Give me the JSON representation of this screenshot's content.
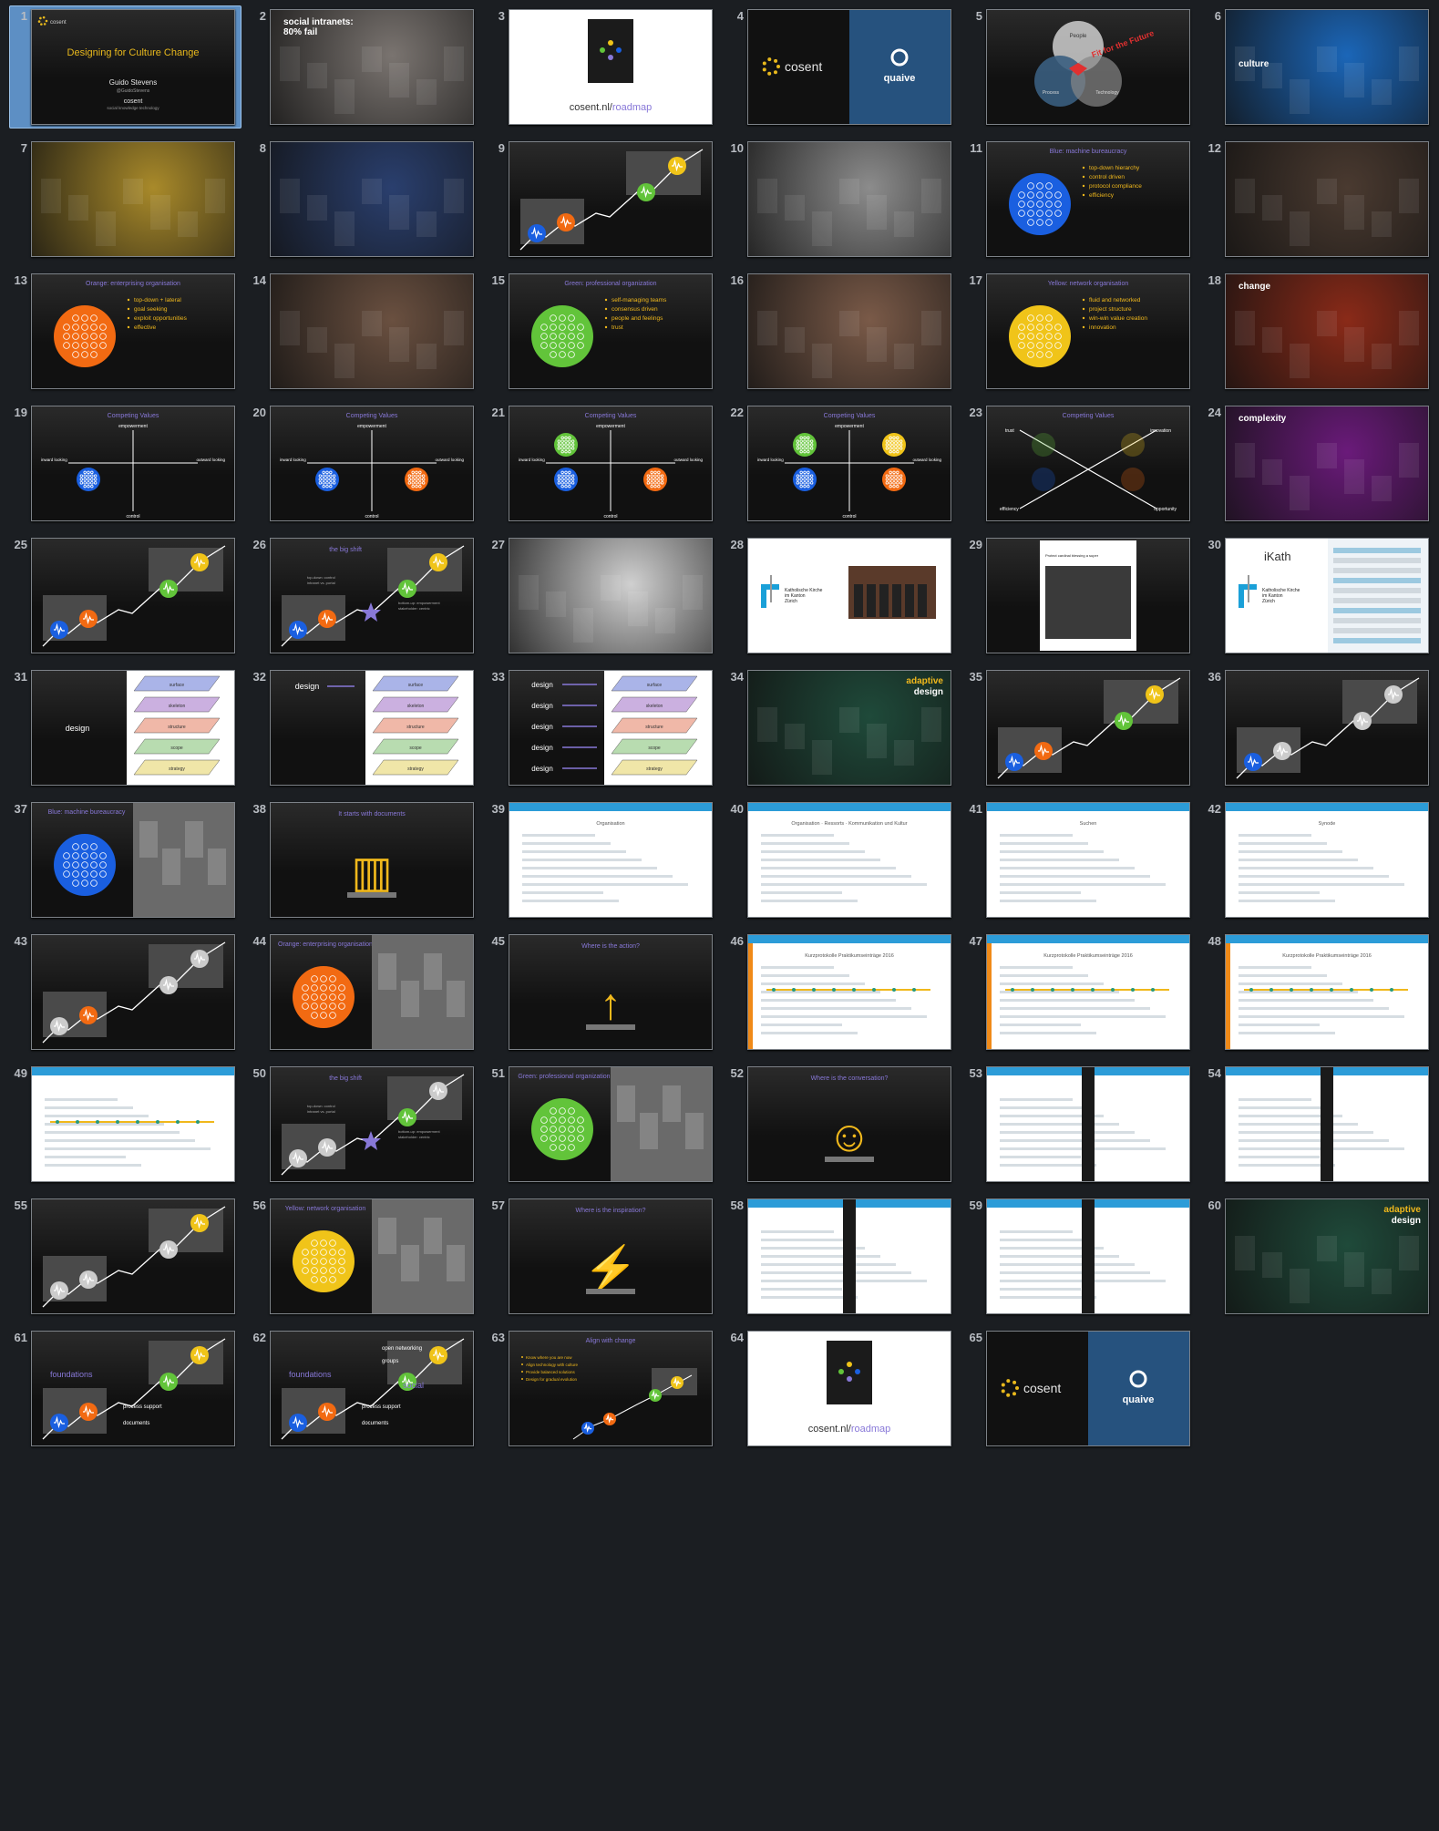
{
  "slides": [
    {
      "n": "1",
      "kind": "title",
      "title": "Designing for Culture Change",
      "author": "Guido Stevens",
      "handle": "@GuidoStevens",
      "brand": "cosent",
      "tagline": "social knowledge technology",
      "logo": "cosent",
      "selected": true
    },
    {
      "n": "2",
      "kind": "photo",
      "caption": "social intranets:\n80% fail",
      "bg": "#7a7470"
    },
    {
      "n": "3",
      "kind": "book",
      "link": "cosent.nl/",
      "link_accent": "roadmap"
    },
    {
      "n": "4",
      "kind": "logos",
      "left": "cosent",
      "right": "quaive"
    },
    {
      "n": "5",
      "kind": "venn",
      "labels": [
        "People",
        "Process",
        "Technology"
      ],
      "stamp": "Fit for the Future"
    },
    {
      "n": "6",
      "kind": "photo",
      "caption": "culture",
      "bg": "#1b66b8"
    },
    {
      "n": "7",
      "kind": "photo",
      "caption": "",
      "bg": "#a98a2a"
    },
    {
      "n": "8",
      "kind": "photo",
      "caption": "",
      "bg": "#2a3f6e"
    },
    {
      "n": "9",
      "kind": "curve",
      "dots": [
        "#1a5fe0",
        "#f26a12",
        "#62c43a",
        "#f0c419"
      ]
    },
    {
      "n": "10",
      "kind": "photo",
      "caption": "",
      "bg": "#8c8c8c"
    },
    {
      "n": "11",
      "kind": "meme",
      "title": "Blue: machine bureaucracy",
      "color": "#1a5fe0",
      "items": [
        "top-down hierarchy",
        "control driven",
        "protocol compliance",
        "efficiency"
      ]
    },
    {
      "n": "12",
      "kind": "photo",
      "caption": "",
      "bg": "#4a3a30"
    },
    {
      "n": "13",
      "kind": "meme",
      "title": "Orange: enterprising organisation",
      "color": "#f26a12",
      "items": [
        "top-down + lateral",
        "goal seeking",
        "exploit opportunities",
        "effective"
      ]
    },
    {
      "n": "14",
      "kind": "photo",
      "caption": "",
      "bg": "#6a5040"
    },
    {
      "n": "15",
      "kind": "meme",
      "title": "Green: professional organization",
      "color": "#62c43a",
      "items": [
        "self-managing teams",
        "consensus driven",
        "people and feelings",
        "trust"
      ]
    },
    {
      "n": "16",
      "kind": "photo",
      "caption": "",
      "bg": "#7a5a48"
    },
    {
      "n": "17",
      "kind": "meme",
      "title": "Yellow: network organisation",
      "color": "#f0c419",
      "items": [
        "fluid and networked",
        "project structure",
        "win-win value creation",
        "innovation"
      ]
    },
    {
      "n": "18",
      "kind": "photo",
      "caption": "change",
      "bg": "#8a2a18"
    },
    {
      "n": "19",
      "kind": "quad",
      "title": "Competing Values",
      "top": "empowerment",
      "bottom": "control",
      "left": "inward looking",
      "right": "outward looking",
      "dots": [
        null,
        null,
        "#1a5fe0",
        null
      ]
    },
    {
      "n": "20",
      "kind": "quad",
      "title": "Competing Values",
      "top": "empowerment",
      "bottom": "control",
      "left": "inward looking",
      "right": "outward looking",
      "dots": [
        null,
        null,
        "#1a5fe0",
        "#f26a12"
      ]
    },
    {
      "n": "21",
      "kind": "quad",
      "title": "Competing Values",
      "top": "empowerment",
      "bottom": "control",
      "left": "inward looking",
      "right": "outward looking",
      "dots": [
        "#62c43a",
        null,
        "#1a5fe0",
        "#f26a12"
      ]
    },
    {
      "n": "22",
      "kind": "quad",
      "title": "Competing Values",
      "top": "empowerment",
      "bottom": "control",
      "left": "inward looking",
      "right": "outward looking",
      "dots": [
        "#62c43a",
        "#f0c419",
        "#1a5fe0",
        "#f26a12"
      ]
    },
    {
      "n": "23",
      "kind": "cross",
      "title": "Competing Values",
      "corners": [
        "trust",
        "innovation",
        "efficiency",
        "opportunity"
      ]
    },
    {
      "n": "24",
      "kind": "photo",
      "caption": "complexity",
      "bg": "#6a1a7a"
    },
    {
      "n": "25",
      "kind": "curve",
      "dots": [
        "#1a5fe0",
        "#f26a12",
        "#62c43a",
        "#f0c419"
      ]
    },
    {
      "n": "26",
      "kind": "curve",
      "dots": [
        "#1a5fe0",
        "#f26a12",
        "#62c43a",
        "#f0c419"
      ],
      "title": "the big shift",
      "star": true,
      "notes": [
        "top-down: control",
        "intranet vs. portal",
        "bottom-up: empowerment",
        "stakeholder: centric"
      ]
    },
    {
      "n": "27",
      "kind": "photo",
      "caption": "",
      "bg": "#d0d0d0"
    },
    {
      "n": "28",
      "kind": "kath",
      "org": "Katholische Kirche\nim Kanton\nZürich"
    },
    {
      "n": "29",
      "kind": "tweet",
      "text": "Protect cardinal blessing a super computer center"
    },
    {
      "n": "30",
      "kind": "ikath",
      "title": "iKath",
      "org": "Katholische Kirche\nim Kanton\nZürich"
    },
    {
      "n": "31",
      "kind": "planes",
      "left": [
        "design"
      ],
      "layers": [
        "surface",
        "skeleton",
        "structure",
        "scope",
        "strategy"
      ]
    },
    {
      "n": "32",
      "kind": "planes",
      "left": [
        "design"
      ],
      "layers": [
        "surface",
        "skeleton",
        "structure",
        "scope",
        "strategy"
      ]
    },
    {
      "n": "33",
      "kind": "planes",
      "left": [
        "design",
        "design",
        "design",
        "design",
        "design"
      ],
      "layers": [
        "surface",
        "skeleton",
        "structure",
        "scope",
        "strategy"
      ]
    },
    {
      "n": "34",
      "kind": "photo",
      "caption": "adaptive\ndesign",
      "bg": "#1f4a3a",
      "accent": true
    },
    {
      "n": "35",
      "kind": "curve",
      "dots": [
        "#1a5fe0",
        "#f26a12",
        "#62c43a",
        "#f0c419"
      ]
    },
    {
      "n": "36",
      "kind": "curve",
      "dots": [
        "#1a5fe0",
        "#cccccc",
        "#cccccc",
        "#cccccc"
      ]
    },
    {
      "n": "37",
      "kind": "meme",
      "title": "Blue: machine bureaucracy",
      "color": "#1a5fe0",
      "items": []
    },
    {
      "n": "38",
      "kind": "icon",
      "title": "It starts with documents",
      "glyph": "▥"
    },
    {
      "n": "39",
      "kind": "screen",
      "heading": "Organisation"
    },
    {
      "n": "40",
      "kind": "screen",
      "heading": "Organisation · Ressorts · Kommunikation und Kultur"
    },
    {
      "n": "41",
      "kind": "screen",
      "heading": "Suchen"
    },
    {
      "n": "42",
      "kind": "screen",
      "heading": "Synode"
    },
    {
      "n": "43",
      "kind": "curve",
      "dots": [
        "#cccccc",
        "#f26a12",
        "#cccccc",
        "#cccccc"
      ]
    },
    {
      "n": "44",
      "kind": "meme",
      "title": "Orange: enterprising organisation",
      "color": "#f26a12",
      "items": []
    },
    {
      "n": "45",
      "kind": "icon",
      "title": "Where is the action?",
      "glyph": "↑"
    },
    {
      "n": "46",
      "kind": "screen",
      "heading": "Kurzprotokolle Praktikumseinträge 2016"
    },
    {
      "n": "47",
      "kind": "screen",
      "heading": "Kurzprotokolle Praktikumseinträge 2016"
    },
    {
      "n": "48",
      "kind": "screen",
      "heading": "Kurzprotokolle Praktikumseinträge 2016"
    },
    {
      "n": "49",
      "kind": "screen",
      "heading": ""
    },
    {
      "n": "50",
      "kind": "curve",
      "dots": [
        "#cccccc",
        "#cccccc",
        "#62c43a",
        "#cccccc"
      ],
      "title": "the big shift",
      "star": true,
      "notes": [
        "top-down: control",
        "intranet vs. portal",
        "bottom-up: empowerment",
        "stakeholder: centric"
      ]
    },
    {
      "n": "51",
      "kind": "meme",
      "title": "Green: professional organization",
      "color": "#62c43a",
      "items": []
    },
    {
      "n": "52",
      "kind": "icon",
      "title": "Where is the conversation?",
      "glyph": "☺"
    },
    {
      "n": "53",
      "kind": "screen",
      "heading": ""
    },
    {
      "n": "54",
      "kind": "screen",
      "heading": ""
    },
    {
      "n": "55",
      "kind": "curve",
      "dots": [
        "#cccccc",
        "#cccccc",
        "#cccccc",
        "#f0c419"
      ]
    },
    {
      "n": "56",
      "kind": "meme",
      "title": "Yellow: network organisation",
      "color": "#f0c419",
      "items": []
    },
    {
      "n": "57",
      "kind": "icon",
      "title": "Where is the inspiration?",
      "glyph": "⚡"
    },
    {
      "n": "58",
      "kind": "screen",
      "heading": ""
    },
    {
      "n": "59",
      "kind": "screen",
      "heading": ""
    },
    {
      "n": "60",
      "kind": "photo",
      "caption": "adaptive\ndesign",
      "bg": "#1f4a3a",
      "accent": true
    },
    {
      "n": "61",
      "kind": "curve",
      "dots": [
        "#1a5fe0",
        "#f26a12",
        "#62c43a",
        "#f0c419"
      ],
      "labels": [
        "foundations",
        "process support",
        "documents"
      ]
    },
    {
      "n": "62",
      "kind": "curve",
      "dots": [
        "#1a5fe0",
        "#f26a12",
        "#62c43a",
        "#f0c419"
      ],
      "labels": [
        "foundations",
        "process support",
        "documents",
        "open networking",
        "groups",
        "social"
      ]
    },
    {
      "n": "63",
      "kind": "align",
      "title": "Align with change",
      "items": [
        "Know where you are now",
        "Align technology with culture",
        "Provide balanced solutions",
        "Design for gradual evolution"
      ]
    },
    {
      "n": "64",
      "kind": "book",
      "link": "cosent.nl/",
      "link_accent": "roadmap"
    },
    {
      "n": "65",
      "kind": "logos",
      "left": "cosent",
      "right": "quaive"
    }
  ]
}
